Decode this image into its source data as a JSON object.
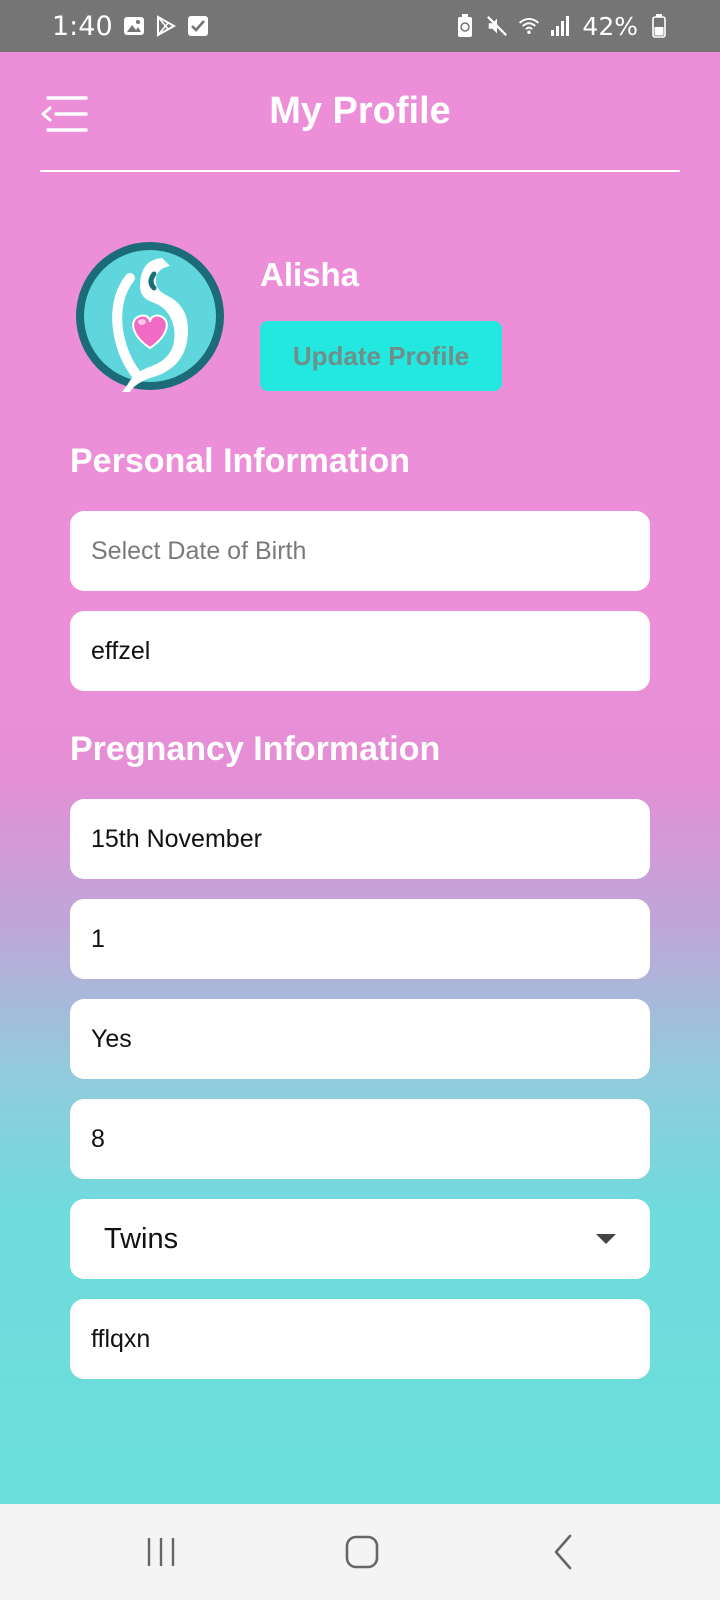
{
  "status_bar": {
    "time": "1:40",
    "battery": "42%",
    "left_icons": [
      "gallery-icon",
      "play-store-icon",
      "checkbox-icon"
    ],
    "right_icons": [
      "recycle-battery-icon",
      "mute-icon",
      "wifi-icon",
      "signal-icon",
      "battery-icon"
    ]
  },
  "header": {
    "title": "My Profile",
    "menu_icon": "menu-collapse-icon"
  },
  "profile": {
    "name": "Alisha",
    "update_button": "Update Profile",
    "avatar_icon": "pregnancy-heart-logo"
  },
  "personal_info": {
    "title": "Personal Information",
    "dob_placeholder": "Select Date of Birth",
    "field2_value": "effzel"
  },
  "pregnancy_info": {
    "title": "Pregnancy Information",
    "fields": [
      "15th November",
      "1",
      "Yes",
      "8"
    ],
    "select_value": "Twins",
    "last_field": "fflqxn"
  },
  "nav": {
    "icons": [
      "recent-apps-icon",
      "home-icon",
      "back-icon"
    ]
  },
  "colors": {
    "status_bar": "#757575",
    "gradient_top": "#ec8fd8",
    "gradient_bottom": "#6cdfdc",
    "button": "#22e8e0",
    "button_text": "#6f8e8c",
    "logo_teal": "#1b6b79",
    "logo_light": "#5fd6db",
    "heart": "#f06cc4"
  }
}
